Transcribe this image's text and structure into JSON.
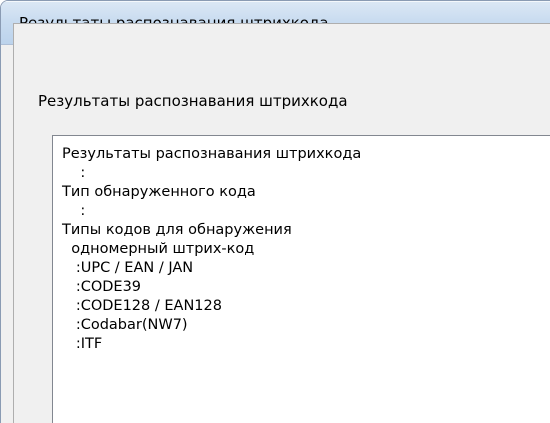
{
  "window": {
    "title": "Результаты распознавания штрихкода"
  },
  "section": {
    "title": "Результаты распознавания штрихкода"
  },
  "results": {
    "lines": [
      "Результаты распознавания штрихкода",
      "    :",
      "Тип обнаруженного кода",
      "    :",
      "Типы кодов для обнаружения",
      "  одномерный штрих-код",
      "   :UPC / EAN / JAN",
      "   :CODE39",
      "   :CODE128 / EAN128",
      "   :Codabar(NW7)",
      "   :ITF"
    ]
  }
}
